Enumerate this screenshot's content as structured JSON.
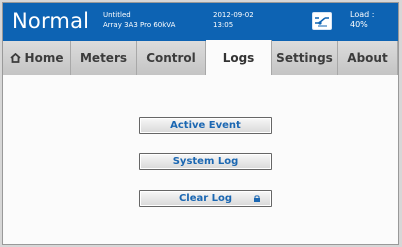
{
  "header": {
    "mode": "Normal",
    "info_line1": "Untitled",
    "info_line2": "Array 3A3 Pro 60kVA",
    "date": "2012-09-02",
    "time": "13:05",
    "load_label": "Load :",
    "load_value": "40%",
    "status_icon": "system-status-icon"
  },
  "tabs": [
    {
      "label": "Home",
      "icon": "home-icon"
    },
    {
      "label": "Meters"
    },
    {
      "label": "Control"
    },
    {
      "label": "Logs",
      "active": true
    },
    {
      "label": "Settings"
    },
    {
      "label": "About"
    }
  ],
  "buttons": {
    "active_event": "Active Event",
    "system_log": "System Log",
    "clear_log": "Clear Log"
  },
  "colors": {
    "header": "#0d63b3",
    "button_text": "#1b67b2"
  }
}
